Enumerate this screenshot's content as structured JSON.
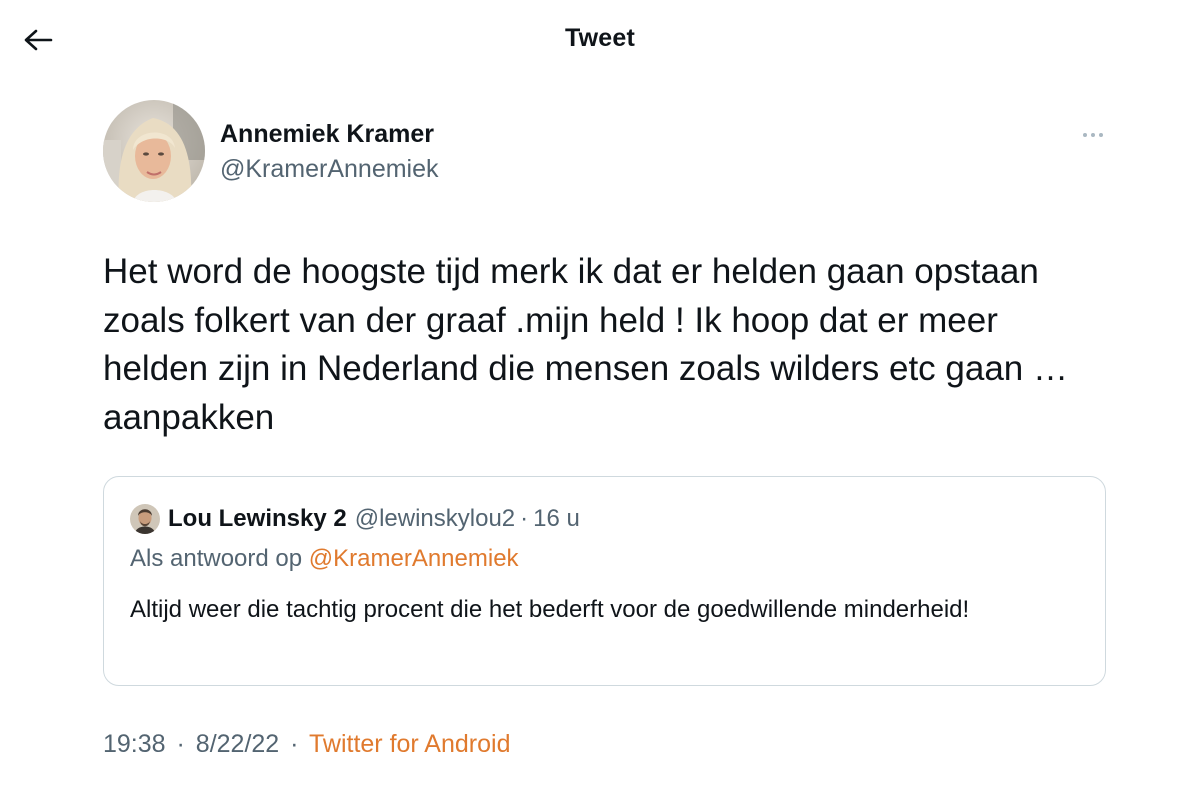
{
  "header": {
    "title": "Tweet",
    "back_icon": "arrow-left-icon"
  },
  "tweet": {
    "author": {
      "name": "Annemiek Kramer",
      "handle": "@KramerAnnemiek",
      "avatar": "profile-photo"
    },
    "more_icon": "more-horizontal-icon",
    "text": "Het word de hoogste tijd merk ik dat er helden gaan opstaan zoals folkert van der graaf .mijn held ! Ik hoop dat er meer helden zijn in Nederland die mensen zoals wilders etc gaan … aanpakken",
    "time": "19:38",
    "date": "8/22/22",
    "separator": "·",
    "source": "Twitter for Android"
  },
  "quoted": {
    "name": "Lou Lewinsky 2",
    "handle": "@lewinskylou2",
    "separator": "·",
    "age": "16 u",
    "reply_prefix": "Als antwoord op",
    "reply_mention": "@KramerAnnemiek",
    "text": "Altijd weer die tachtig procent die het bederft voor de goedwillende minderheid!"
  },
  "colors": {
    "text_primary": "#0f1419",
    "text_secondary": "#536471",
    "accent": "#e07a2e",
    "border": "#cfd9de"
  }
}
